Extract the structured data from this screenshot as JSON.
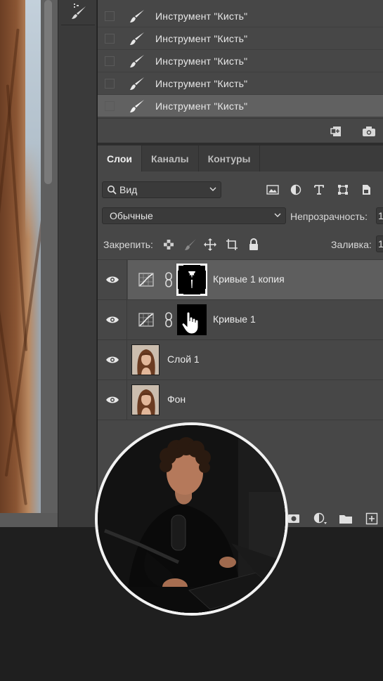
{
  "history": {
    "items": [
      {
        "label": "Инструмент \"Кисть\""
      },
      {
        "label": "Инструмент \"Кисть\""
      },
      {
        "label": "Инструмент \"Кисть\""
      },
      {
        "label": "Инструмент \"Кисть\""
      },
      {
        "label": "Инструмент \"Кисть\""
      }
    ],
    "footer_icons": [
      "new-document-from-state-icon",
      "camera-snapshot-icon"
    ]
  },
  "layers_panel": {
    "tabs": [
      {
        "label": "Слои",
        "active": true
      },
      {
        "label": "Каналы",
        "active": false
      },
      {
        "label": "Контуры",
        "active": false
      }
    ],
    "filter": {
      "value": "Вид",
      "icons": [
        "image-filter-icon",
        "adjustment-filter-icon",
        "type-filter-icon",
        "shape-filter-icon",
        "smart-object-filter-icon"
      ]
    },
    "blend_mode": "Обычные",
    "opacity_label": "Непрозрачность:",
    "opacity_value": "1",
    "lock_label": "Закрепить:",
    "lock_icons": [
      "lock-transparent-icon",
      "lock-paint-icon",
      "lock-move-icon",
      "lock-artboard-icon",
      "lock-all-icon"
    ],
    "fill_label": "Заливка:",
    "fill_value": "1",
    "layers": [
      {
        "name": "Кривые 1 копия",
        "type": "adjustment",
        "selected": true
      },
      {
        "name": "Кривые 1",
        "type": "adjustment",
        "selected": false
      },
      {
        "name": "Слой 1",
        "type": "pixel",
        "selected": false
      },
      {
        "name": "Фон",
        "type": "pixel",
        "selected": false
      }
    ],
    "bottom_icons": [
      "add-mask-icon",
      "new-adjustment-layer-icon",
      "new-group-icon",
      "new-layer-icon"
    ]
  },
  "colors": {
    "panel": "#474747",
    "selected_row": "#5e5e5e",
    "text": "#e6e6e6",
    "webcam_border": "#f2f2f2"
  }
}
